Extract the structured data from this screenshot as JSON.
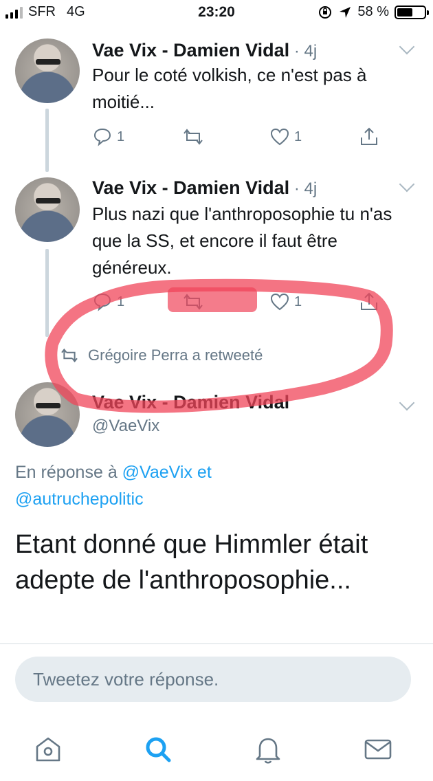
{
  "status_bar": {
    "carrier": "SFR",
    "network": "4G",
    "time": "23:20",
    "battery": "58 %",
    "battery_level": 0.58
  },
  "tweets": [
    {
      "author": "Vae Vix - Damien Vidal",
      "age": "4j",
      "text": "Pour le coté volkish, ce n'est pas à moitié...",
      "reply_count": "1",
      "like_count": "1"
    },
    {
      "author": "Vae Vix - Damien Vidal",
      "age": "4j",
      "text": "Plus nazi que l'anthroposophie tu n'as que la SS, et encore il faut être généreux.",
      "reply_count": "1",
      "like_count": "1"
    }
  ],
  "retweet_note": "Grégoire Perra a retweeté",
  "main_tweet": {
    "author": "Vae Vix - Damien Vidal",
    "handle": "@VaeVix",
    "reply_prefix": "En réponse à",
    "reply_mention_1": "@VaeVix",
    "reply_joiner": "et",
    "reply_mention_2": "@autruchepolitic",
    "text": "Etant donné que Himmler était adepte de l'anthroposophie..."
  },
  "reply_box": {
    "placeholder": "Tweetez votre réponse."
  },
  "tabbar": {
    "items": [
      {
        "icon": "home-icon",
        "active": false
      },
      {
        "icon": "search-icon",
        "active": true
      },
      {
        "icon": "bell-icon",
        "active": false
      },
      {
        "icon": "mail-icon",
        "active": false
      }
    ]
  },
  "colors": {
    "accent": "#1da1f2",
    "secondary_text": "#657786",
    "annotation": "#f0455a"
  }
}
